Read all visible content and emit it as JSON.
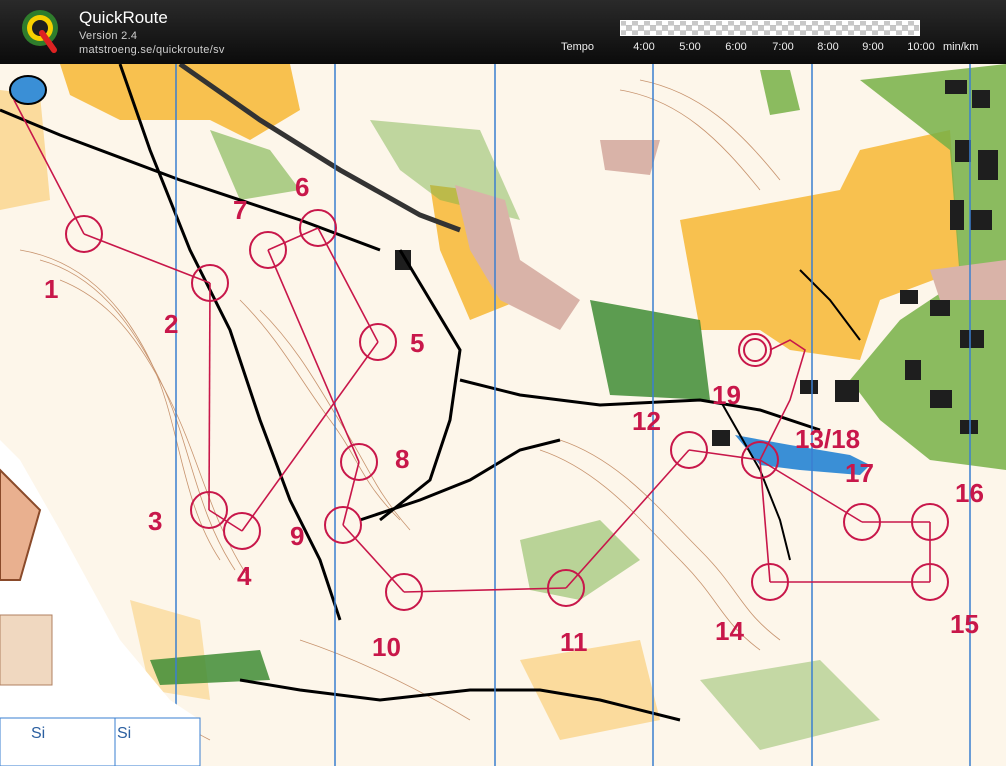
{
  "app": {
    "name": "QuickRoute",
    "version": "Version 2.4",
    "url": "matstroeng.se/quickroute/sv",
    "logo_letter": "Q"
  },
  "tempo": {
    "label": "Tempo",
    "ticks": [
      "4:00",
      "5:00",
      "6:00",
      "7:00",
      "8:00",
      "9:00",
      "10:00"
    ],
    "unit": "min/km"
  },
  "map": {
    "control_numbers": [
      "1",
      "2",
      "3",
      "4",
      "5",
      "6",
      "7",
      "8",
      "9",
      "10",
      "11",
      "12",
      "13/18",
      "14",
      "15",
      "16",
      "17",
      "19"
    ],
    "map_text": [
      "Si",
      "Si"
    ],
    "colors": {
      "course": "#c8174a",
      "open_land": "#f7b733",
      "forest_green": "#76b046",
      "dark_green": "#2f7d2c",
      "road": "#000000",
      "water": "#3a8fd6",
      "magnetic_north_lines": "#3a7fd0",
      "paved_area": "#d9b3a8"
    }
  }
}
